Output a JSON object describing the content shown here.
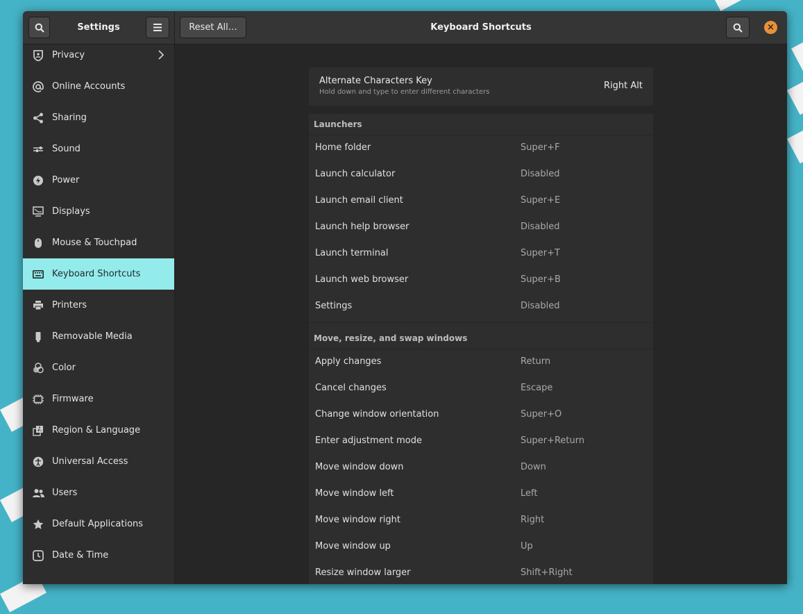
{
  "window": {
    "sidebar_title": "Settings",
    "reset_label": "Reset All…",
    "page_title": "Keyboard Shortcuts",
    "close_glyph": "×"
  },
  "sidebar": {
    "items": [
      {
        "label": "Privacy",
        "icon": "privacy-icon"
      },
      {
        "label": "Online Accounts",
        "icon": "at-icon"
      },
      {
        "label": "Sharing",
        "icon": "share-icon"
      },
      {
        "label": "Sound",
        "icon": "sound-icon"
      },
      {
        "label": "Power",
        "icon": "power-icon"
      },
      {
        "label": "Displays",
        "icon": "display-icon"
      },
      {
        "label": "Mouse & Touchpad",
        "icon": "mouse-icon"
      },
      {
        "label": "Keyboard Shortcuts",
        "icon": "keyboard-icon"
      },
      {
        "label": "Printers",
        "icon": "printer-icon"
      },
      {
        "label": "Removable Media",
        "icon": "usb-icon"
      },
      {
        "label": "Color",
        "icon": "color-icon"
      },
      {
        "label": "Firmware",
        "icon": "chip-icon"
      },
      {
        "label": "Region & Language",
        "icon": "language-icon"
      },
      {
        "label": "Universal Access",
        "icon": "accessibility-icon"
      },
      {
        "label": "Users",
        "icon": "users-icon"
      },
      {
        "label": "Default Applications",
        "icon": "star-icon"
      },
      {
        "label": "Date & Time",
        "icon": "clock-icon"
      }
    ],
    "active_index": 7
  },
  "alt_key": {
    "title": "Alternate Characters Key",
    "subtitle": "Hold down and type to enter different characters",
    "value": "Right Alt"
  },
  "sections": [
    {
      "title": "Launchers",
      "rows": [
        {
          "label": "Home folder",
          "accel": "Super+F"
        },
        {
          "label": "Launch calculator",
          "accel": "Disabled"
        },
        {
          "label": "Launch email client",
          "accel": "Super+E"
        },
        {
          "label": "Launch help browser",
          "accel": "Disabled"
        },
        {
          "label": "Launch terminal",
          "accel": "Super+T"
        },
        {
          "label": "Launch web browser",
          "accel": "Super+B"
        },
        {
          "label": "Settings",
          "accel": "Disabled"
        }
      ]
    },
    {
      "title": "Move, resize, and swap windows",
      "rows": [
        {
          "label": "Apply changes",
          "accel": "Return"
        },
        {
          "label": "Cancel changes",
          "accel": "Escape"
        },
        {
          "label": "Change window orientation",
          "accel": "Super+O"
        },
        {
          "label": "Enter adjustment mode",
          "accel": "Super+Return"
        },
        {
          "label": "Move window down",
          "accel": "Down"
        },
        {
          "label": "Move window left",
          "accel": "Left"
        },
        {
          "label": "Move window right",
          "accel": "Right"
        },
        {
          "label": "Move window up",
          "accel": "Up"
        },
        {
          "label": "Resize window larger",
          "accel": "Shift+Right"
        }
      ]
    }
  ]
}
